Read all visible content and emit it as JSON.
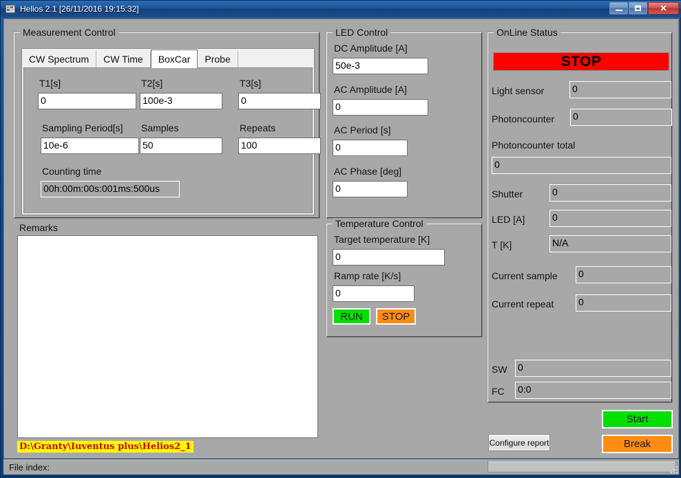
{
  "window": {
    "title": "Helios 2.1 [26/11/2016 19:15:32]",
    "icon": "application-icon",
    "minimize_label": "",
    "maximize_label": "",
    "close_label": "✕"
  },
  "measurement_control": {
    "title": "Measurement Control",
    "tabs": [
      {
        "label": "CW Spectrum",
        "selected": false
      },
      {
        "label": "CW Time",
        "selected": false
      },
      {
        "label": "BoxCar",
        "selected": true
      },
      {
        "label": "Probe",
        "selected": false
      }
    ],
    "fields": {
      "t1_label": "T1[s]",
      "t1_value": "0",
      "t2_label": "T2[s]",
      "t2_value": "100e-3",
      "t3_label": "T3[s]",
      "t3_value": "0",
      "sampling_period_label": "Sampling Period[s]",
      "sampling_period_value": "10e-6",
      "samples_label": "Samples",
      "samples_value": "50",
      "repeats_label": "Repeats",
      "repeats_value": "100",
      "counting_time_label": "Counting time",
      "counting_time_value": "00h:00m:00s:001ms:500us"
    }
  },
  "led_control": {
    "title": "LED Control",
    "fields": [
      {
        "label": "DC Amplitude [A]",
        "value": "50e-3"
      },
      {
        "label": "AC Amplitude [A]",
        "value": "0"
      },
      {
        "label": "AC Period [s]",
        "value": "0"
      },
      {
        "label": "AC Phase [deg]",
        "value": "0"
      }
    ]
  },
  "temperature_control": {
    "title": "Temperature Control",
    "target_label": "Target temperature [K]",
    "target_value": "0",
    "ramp_label": "Ramp rate [K/s]",
    "ramp_value": "0",
    "run_label": "RUN",
    "stop_label": "STOP",
    "run_color": "#00e000",
    "stop_color": "#ff8c12"
  },
  "online_status": {
    "title": "OnLine Status",
    "banner_text": "STOP",
    "banner_color": "#ff0000",
    "rows": [
      {
        "label": "Light sensor",
        "value": "0"
      },
      {
        "label": "Photoncounter",
        "value": "0"
      },
      {
        "label": "Shutter",
        "value": "0"
      },
      {
        "label": "LED [A]",
        "value": "0"
      },
      {
        "label": "T [K]",
        "value": "N/A"
      },
      {
        "label": "Current sample",
        "value": "0"
      },
      {
        "label": "Current repeat",
        "value": "0"
      }
    ],
    "photoncounter_total_label": "Photoncounter total",
    "photoncounter_total_value": "0",
    "sw_label": "SW",
    "sw_value": "0",
    "fc_label": "FC",
    "fc_value": "0:0"
  },
  "remarks": {
    "title": "Remarks",
    "text": "",
    "path_label": "D:\\Granty\\Iuventus plus\\Helios2_1",
    "path_bg_color": "#ffff00",
    "path_text_color": "#d40000"
  },
  "actions": {
    "start_label": "Start",
    "break_label": "Break",
    "configure_report_label": "Configure report",
    "start_color": "#00e000",
    "break_color": "#ff8c12"
  },
  "statusbar": {
    "file_index_label": "File index:",
    "progress_percent": 0
  }
}
